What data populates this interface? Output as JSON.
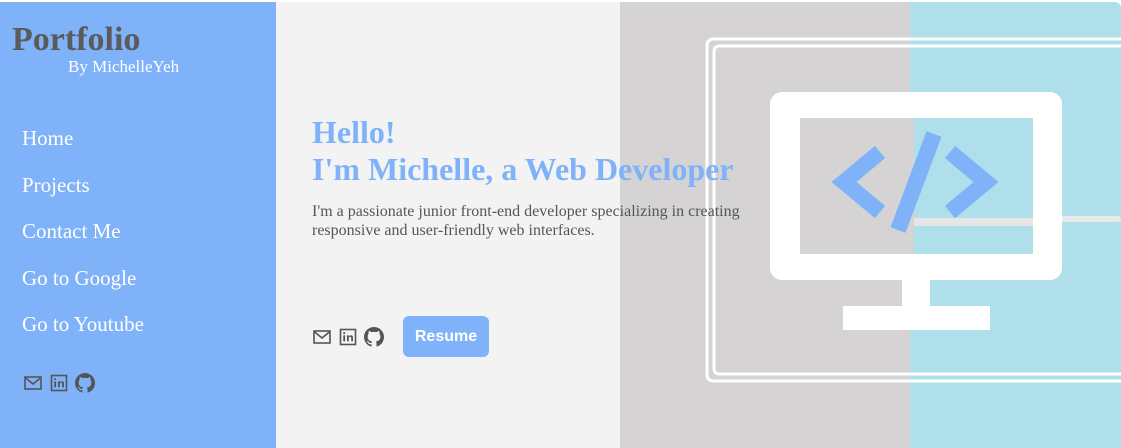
{
  "sidebar": {
    "title": "Portfolio",
    "subtitle": "By MichelleYeh",
    "nav": [
      {
        "label": "Home"
      },
      {
        "label": "Projects"
      },
      {
        "label": "Contact Me"
      },
      {
        "label": "Go to Google"
      },
      {
        "label": "Go to Youtube"
      }
    ],
    "icons": [
      "mail-icon",
      "linkedin-icon",
      "github-icon"
    ]
  },
  "hero": {
    "greeting": "Hello!",
    "headline": "I'm Michelle, a Web Developer",
    "intro": "I'm a passionate junior front-end developer specializing in creating responsive and user-friendly web interfaces.",
    "icons": [
      "mail-icon",
      "linkedin-icon",
      "github-icon"
    ],
    "resume_label": "Resume"
  },
  "colors": {
    "accent": "#7fb2f8",
    "sidebar_title": "#5b5b5b",
    "body_text": "#555555",
    "hero_bg": "#f3f3f3",
    "art_gray": "#d5d3d4",
    "art_blue": "#b0dfec"
  }
}
